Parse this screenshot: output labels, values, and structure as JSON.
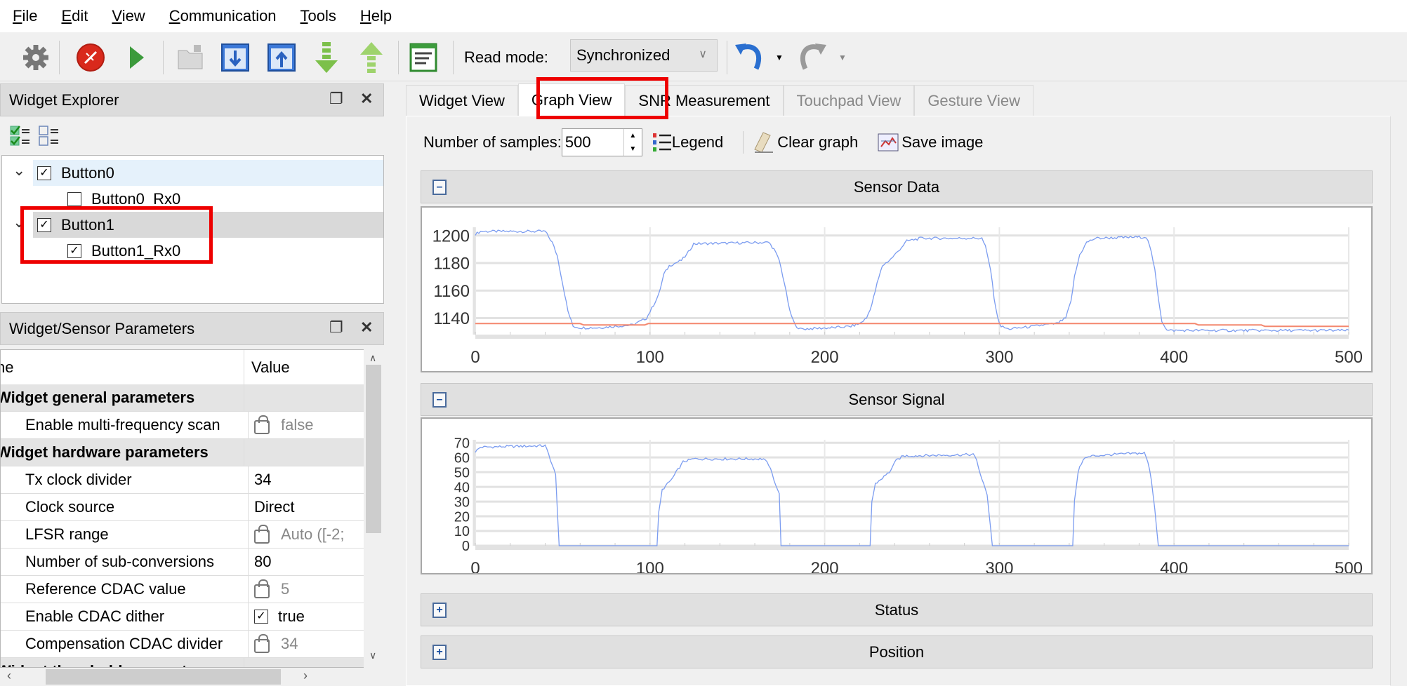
{
  "menu": [
    {
      "label": "File",
      "accel": "F",
      "rest": "ile"
    },
    {
      "label": "Edit",
      "accel": "E",
      "rest": "dit"
    },
    {
      "label": "View",
      "accel": "V",
      "rest": "iew"
    },
    {
      "label": "Communication",
      "accel": "C",
      "rest": "ommunication"
    },
    {
      "label": "Tools",
      "accel": "T",
      "rest": "ools"
    },
    {
      "label": "Help",
      "accel": "H",
      "rest": "elp"
    }
  ],
  "toolbar": {
    "icons": [
      "gear-icon",
      "stop-icon",
      "play-icon",
      "open-folder-icon",
      "read-from-device-icon",
      "write-to-device-icon",
      "import-icon",
      "export-icon",
      "log-icon",
      "undo-icon",
      "redo-icon"
    ],
    "read_mode_label": "Read mode:",
    "read_mode_value": "Synchronized"
  },
  "widget_explorer": {
    "title": "Widget Explorer",
    "tree": [
      {
        "label": "Button0",
        "checked": true,
        "level": 0,
        "expanded": true
      },
      {
        "label": "Button0_Rx0",
        "checked": false,
        "level": 1
      },
      {
        "label": "Button1",
        "checked": true,
        "level": 0,
        "expanded": true,
        "selected": true
      },
      {
        "label": "Button1_Rx0",
        "checked": true,
        "level": 1
      }
    ]
  },
  "parameters": {
    "title": "Widget/Sensor Parameters",
    "col_name": "ne",
    "col_value": "Value",
    "rows": [
      {
        "type": "group",
        "name": "Widget general parameters"
      },
      {
        "name": "Enable multi-frequency scan",
        "value": "false",
        "locked": true
      },
      {
        "type": "group",
        "name": "Widget hardware parameters"
      },
      {
        "name": "Tx clock divider",
        "value": "34"
      },
      {
        "name": "Clock source",
        "value": "Direct"
      },
      {
        "name": "LFSR range",
        "value": "Auto ([-2;",
        "locked": true
      },
      {
        "name": "Number of sub-conversions",
        "value": "80"
      },
      {
        "name": "Reference CDAC value",
        "value": "5",
        "locked": true
      },
      {
        "name": "Enable CDAC dither",
        "value": "true",
        "checkbox": true
      },
      {
        "name": "Compensation CDAC divider",
        "value": "34",
        "locked": true
      },
      {
        "type": "group",
        "name": "Widget threshold parameters"
      }
    ]
  },
  "tabs": [
    {
      "label": "Widget View",
      "state": "normal"
    },
    {
      "label": "Graph View",
      "state": "active"
    },
    {
      "label": "SNR Measurement",
      "state": "normal"
    },
    {
      "label": "Touchpad View",
      "state": "disabled"
    },
    {
      "label": "Gesture View",
      "state": "disabled"
    }
  ],
  "graph_toolbar": {
    "samples_label": "Number of samples:",
    "samples_value": "500",
    "legend_label": "Legend",
    "clear_label": "Clear graph",
    "save_label": "Save image"
  },
  "sections": {
    "sensor_data": "Sensor Data",
    "sensor_signal": "Sensor Signal",
    "status": "Status",
    "position": "Position"
  },
  "colors": {
    "raw": "#7b9cf0",
    "baseline": "#f4876e",
    "highlight": "#ee0000"
  },
  "chart_data": [
    {
      "type": "line",
      "xlim": [
        0,
        500
      ],
      "ylim": [
        1128,
        1206
      ],
      "xticks": [
        0,
        100,
        200,
        300,
        400,
        500
      ],
      "yticks": [
        1140,
        1160,
        1180,
        1200
      ],
      "grid": true,
      "series": [
        {
          "points": [
            [
              0,
              1201
            ],
            [
              3,
              1203
            ],
            [
              40,
              1203
            ],
            [
              44,
              1195
            ],
            [
              47,
              1185
            ],
            [
              50,
              1165
            ],
            [
              53,
              1145
            ],
            [
              56,
              1134
            ],
            [
              60,
              1133
            ],
            [
              70,
              1133
            ],
            [
              90,
              1135
            ],
            [
              95,
              1138
            ],
            [
              98,
              1140
            ],
            [
              101,
              1147
            ],
            [
              105,
              1157
            ],
            [
              108,
              1172
            ],
            [
              111,
              1178
            ],
            [
              118,
              1182
            ],
            [
              121,
              1186
            ],
            [
              125,
              1194
            ],
            [
              168,
              1195
            ],
            [
              171,
              1190
            ],
            [
              174,
              1182
            ],
            [
              177,
              1165
            ],
            [
              180,
              1145
            ],
            [
              183,
              1135
            ],
            [
              186,
              1132
            ],
            [
              205,
              1133
            ],
            [
              215,
              1134
            ],
            [
              220,
              1136
            ],
            [
              224,
              1140
            ],
            [
              227,
              1150
            ],
            [
              230,
              1165
            ],
            [
              233,
              1178
            ],
            [
              238,
              1183
            ],
            [
              243,
              1190
            ],
            [
              247,
              1196
            ],
            [
              255,
              1198
            ],
            [
              290,
              1198
            ],
            [
              292,
              1192
            ],
            [
              295,
              1175
            ],
            [
              297,
              1155
            ],
            [
              299,
              1140
            ],
            [
              301,
              1134
            ],
            [
              305,
              1132
            ],
            [
              320,
              1134
            ],
            [
              325,
              1135
            ],
            [
              333,
              1136
            ],
            [
              338,
              1140
            ],
            [
              341,
              1152
            ],
            [
              343,
              1170
            ],
            [
              346,
              1186
            ],
            [
              350,
              1195
            ],
            [
              355,
              1198
            ],
            [
              384,
              1199
            ],
            [
              386,
              1193
            ],
            [
              389,
              1175
            ],
            [
              391,
              1155
            ],
            [
              393,
              1138
            ],
            [
              396,
              1131
            ],
            [
              500,
              1131
            ]
          ]
        },
        {
          "points": [
            [
              0,
              1136
            ],
            [
              60,
              1136
            ],
            [
              62,
              1135
            ],
            [
              97,
              1135
            ],
            [
              99,
              1136
            ],
            [
              412,
              1136
            ],
            [
              414,
              1135
            ],
            [
              450,
              1135
            ],
            [
              452,
              1134
            ],
            [
              500,
              1134
            ]
          ]
        }
      ]
    },
    {
      "type": "line",
      "xlim": [
        0,
        500
      ],
      "ylim": [
        0,
        72
      ],
      "xticks": [
        0,
        100,
        200,
        300,
        400,
        500
      ],
      "yticks": [
        0,
        10,
        20,
        30,
        40,
        50,
        60,
        70
      ],
      "grid": true,
      "series": [
        {
          "points": [
            [
              0,
              64
            ],
            [
              3,
              67
            ],
            [
              40,
              68
            ],
            [
              42,
              62
            ],
            [
              44,
              55
            ],
            [
              46,
              48
            ],
            [
              48,
              0
            ],
            [
              104,
              0
            ],
            [
              105,
              22
            ],
            [
              107,
              38
            ],
            [
              110,
              42
            ],
            [
              113,
              46
            ],
            [
              115,
              50
            ],
            [
              119,
              57
            ],
            [
              125,
              59
            ],
            [
              165,
              59
            ],
            [
              168,
              55
            ],
            [
              171,
              45
            ],
            [
              174,
              35
            ],
            [
              175,
              0
            ],
            [
              226,
              0
            ],
            [
              227,
              30
            ],
            [
              229,
              42
            ],
            [
              233,
              46
            ],
            [
              237,
              50
            ],
            [
              241,
              58
            ],
            [
              245,
              61
            ],
            [
              285,
              62
            ],
            [
              287,
              58
            ],
            [
              290,
              45
            ],
            [
              293,
              35
            ],
            [
              296,
              0
            ],
            [
              342,
              0
            ],
            [
              343,
              30
            ],
            [
              345,
              50
            ],
            [
              348,
              59
            ],
            [
              353,
              61
            ],
            [
              365,
              62
            ],
            [
              383,
              63
            ],
            [
              385,
              57
            ],
            [
              387,
              45
            ],
            [
              389,
              25
            ],
            [
              391,
              0
            ],
            [
              500,
              0
            ]
          ]
        }
      ]
    }
  ]
}
